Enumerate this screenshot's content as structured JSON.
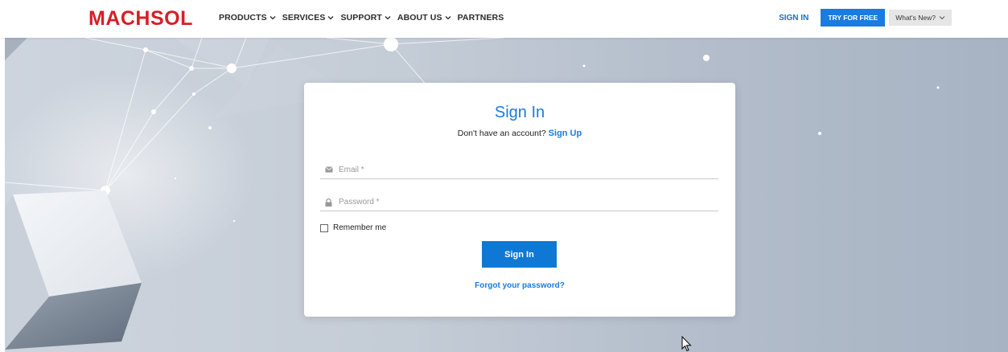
{
  "header": {
    "logo": "MACHSOL",
    "nav": [
      {
        "label": "PRODUCTS",
        "has_dropdown": true
      },
      {
        "label": "SERVICES",
        "has_dropdown": true
      },
      {
        "label": "SUPPORT",
        "has_dropdown": true
      },
      {
        "label": "ABOUT US",
        "has_dropdown": true
      },
      {
        "label": "PARTNERS",
        "has_dropdown": false
      }
    ],
    "sign_in": "SIGN IN",
    "try_free": "TRY FOR FREE",
    "whats_new": "What's New?"
  },
  "form": {
    "title": "Sign In",
    "signup_prompt": "Don't have an account?",
    "signup_link": "Sign Up",
    "email_placeholder": "Email *",
    "email_icon": "envelope-icon",
    "password_placeholder": "Password *",
    "password_icon": "lock-icon",
    "remember_label": "Remember me",
    "remember_checked": false,
    "submit_label": "Sign In",
    "forgot_link": "Forgot your password?"
  },
  "colors": {
    "brand_red": "#d71f27",
    "accent_blue": "#1a7be0",
    "button_blue": "#0f78d4"
  }
}
